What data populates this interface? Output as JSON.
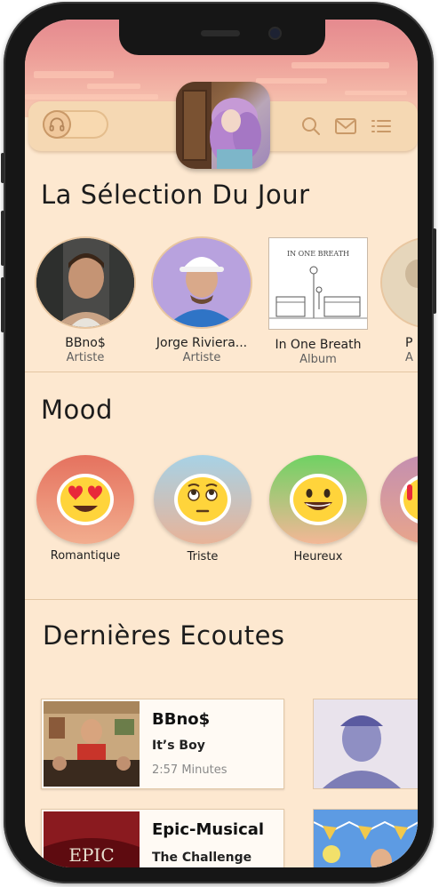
{
  "header": {
    "toggle_icon": "headphones-icon",
    "actions": [
      {
        "name": "search-icon"
      },
      {
        "name": "mail-icon"
      },
      {
        "name": "list-icon"
      }
    ]
  },
  "selection": {
    "title": "La Sélection Du Jour",
    "items": [
      {
        "name": "BBno$",
        "type": "Artiste"
      },
      {
        "name": "Jorge Riviera...",
        "type": "Artiste"
      },
      {
        "name": "In One Breath",
        "type": "Album",
        "cover_text": "IN ONE BREATH"
      },
      {
        "name": "P",
        "type": "A"
      }
    ]
  },
  "mood": {
    "title": "Mood",
    "items": [
      {
        "label": "Romantique",
        "emoji": "heart-eyes-icon",
        "colors": [
          "#e8806e",
          "#f0a88a"
        ]
      },
      {
        "label": "Triste",
        "emoji": "sad-face-icon",
        "colors": [
          "#a9d0e2",
          "#e8b49a"
        ]
      },
      {
        "label": "Heureux",
        "emoji": "smile-icon",
        "colors": [
          "#7cd46b",
          "#f2b394"
        ]
      }
    ]
  },
  "recent": {
    "title": "Dernières Ecoutes",
    "items": [
      {
        "title": "BBno$",
        "subtitle": "It’s Boy",
        "duration": "2:57 Minutes"
      },
      {
        "title": "Epic-Musical",
        "subtitle": "The Challenge",
        "cover_text": "EPIC"
      }
    ]
  },
  "colors": {
    "background": "#fde8d0",
    "bar": "#f5d8b3",
    "accent": "#c99968"
  }
}
